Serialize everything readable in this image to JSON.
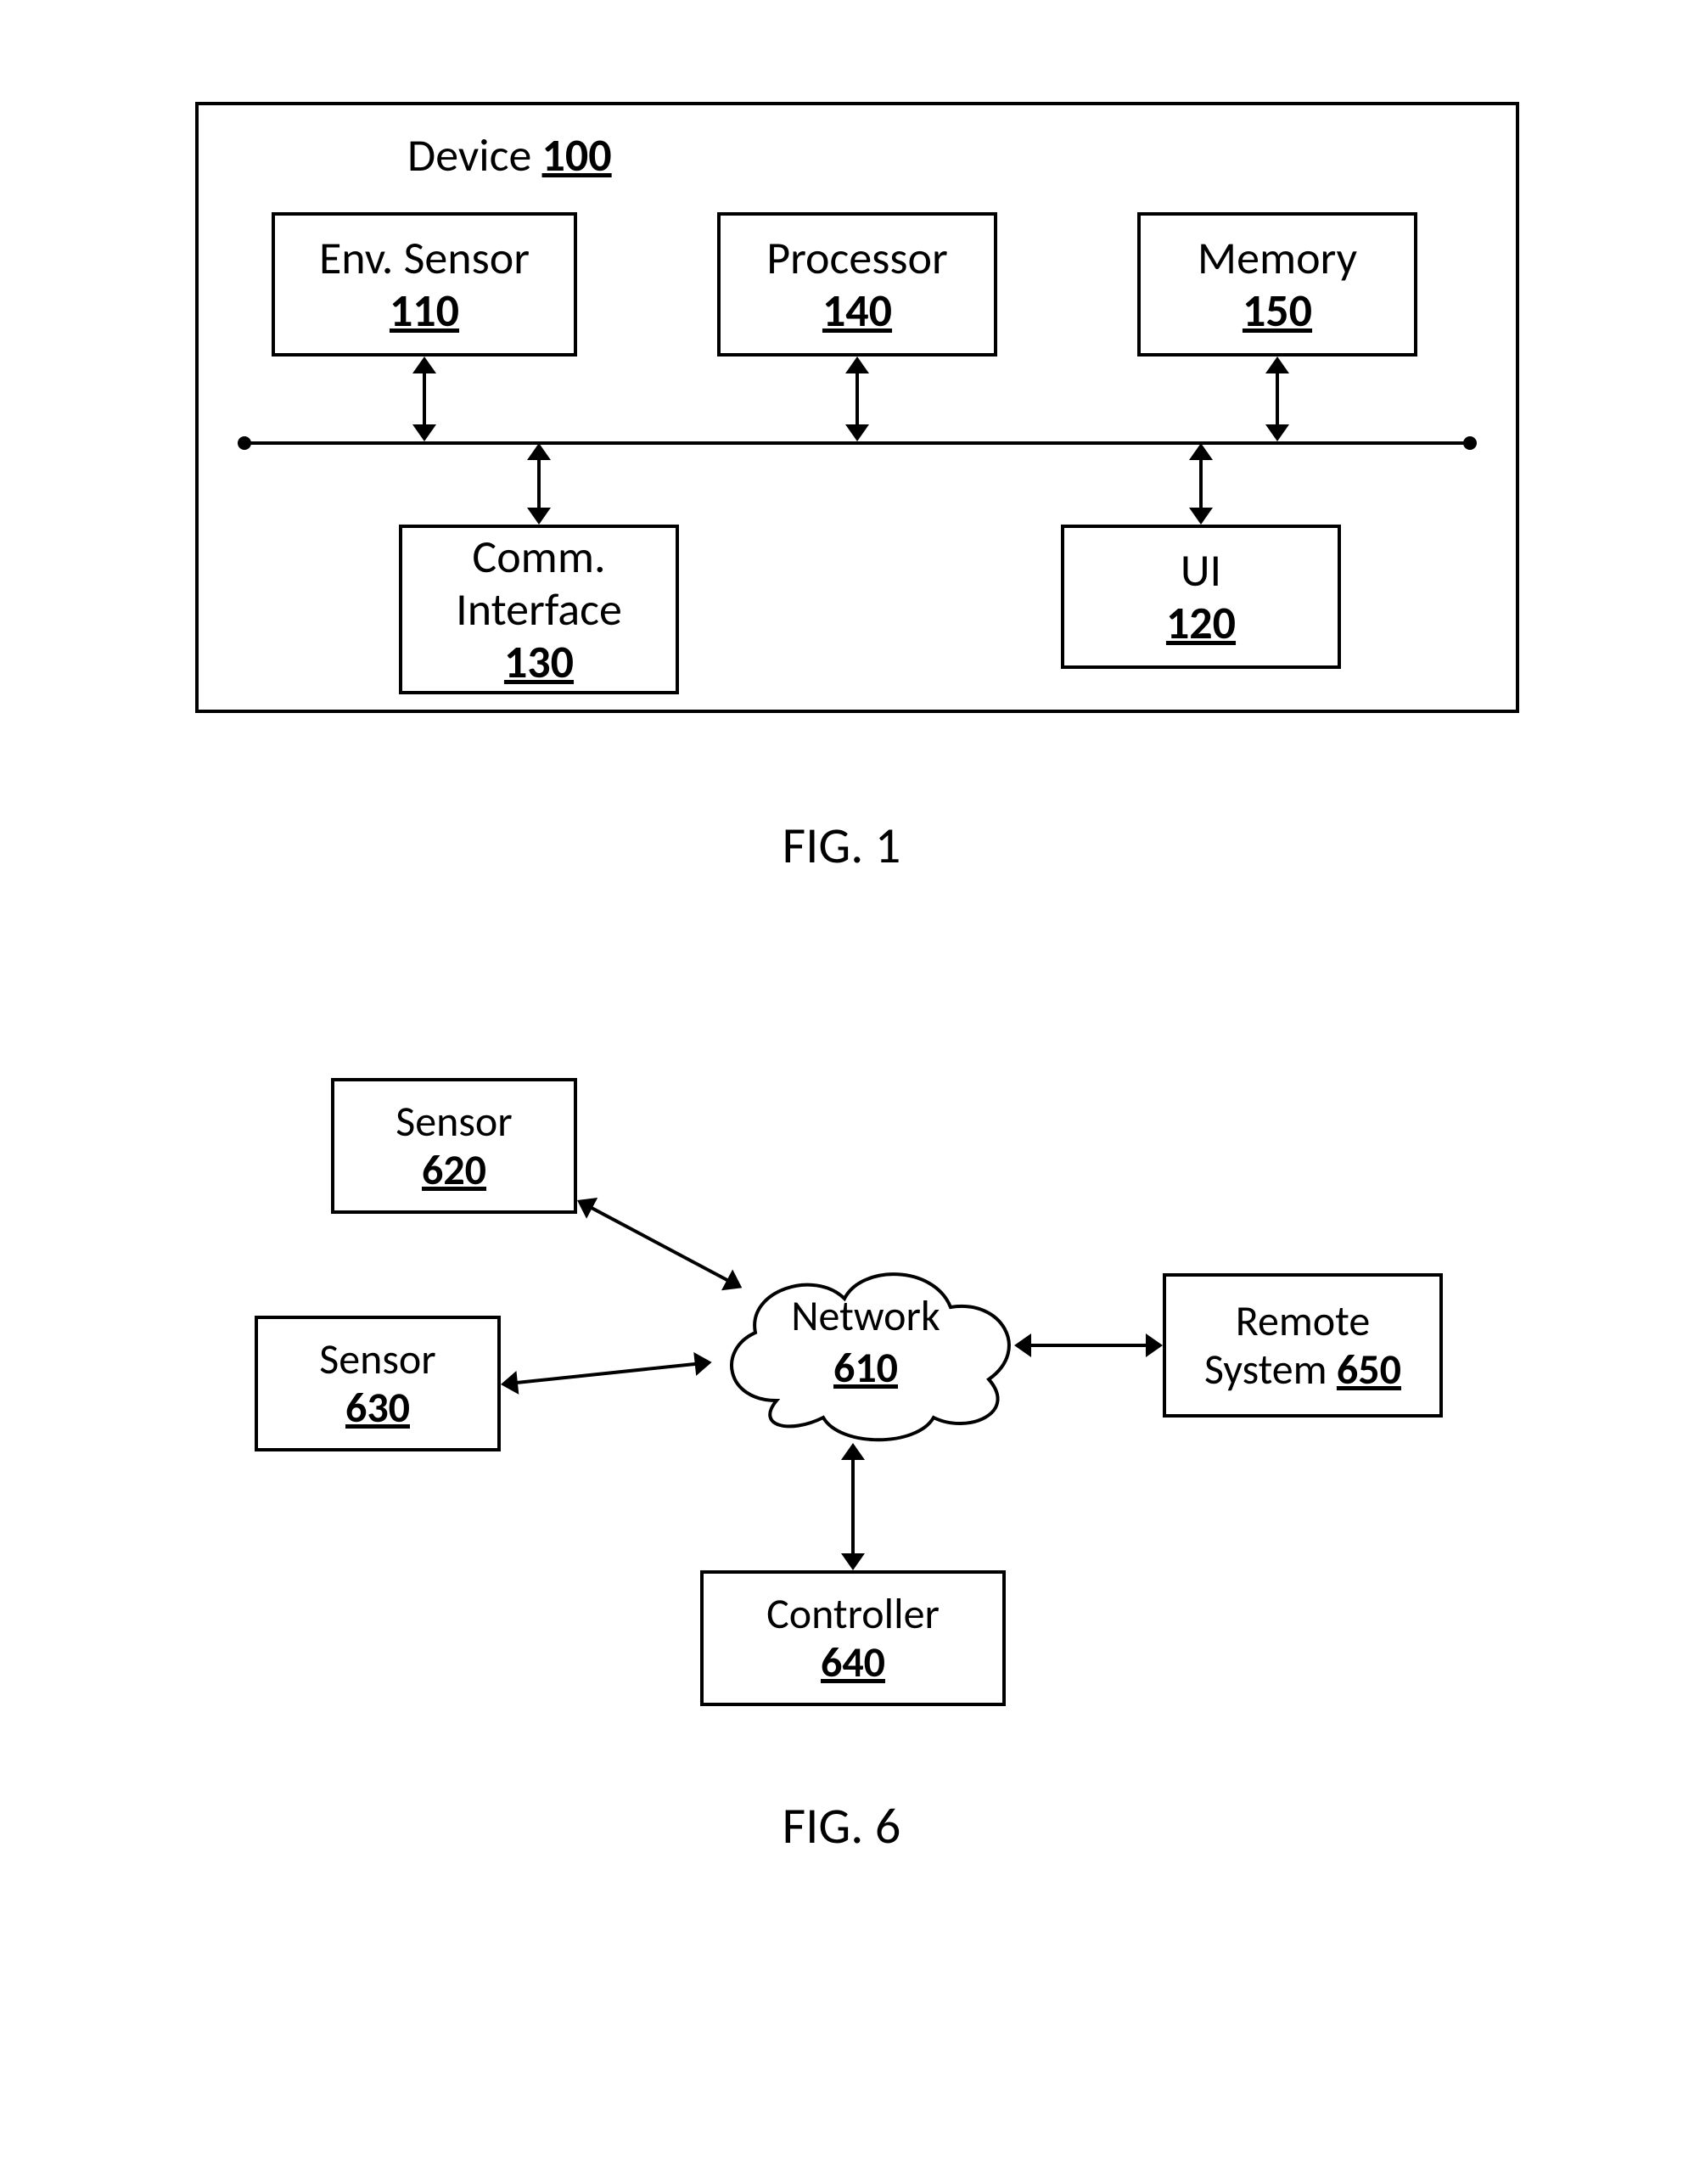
{
  "fig1": {
    "caption": "FIG. 1",
    "device": {
      "label": "Device",
      "ref": "100"
    },
    "blocks": {
      "envSensor": {
        "label": "Env. Sensor",
        "ref": "110"
      },
      "processor": {
        "label": "Processor",
        "ref": "140"
      },
      "memory": {
        "label": "Memory",
        "ref": "150"
      },
      "commIf": {
        "line1": "Comm.",
        "line2": "Interface",
        "ref": "130"
      },
      "ui": {
        "label": "UI",
        "ref": "120"
      }
    }
  },
  "fig6": {
    "caption": "FIG. 6",
    "network": {
      "label": "Network",
      "ref": "610"
    },
    "sensorA": {
      "label": "Sensor",
      "ref": "620"
    },
    "sensorB": {
      "label": "Sensor",
      "ref": "630"
    },
    "controller": {
      "label": "Controller",
      "ref": "640"
    },
    "remote": {
      "line1": "Remote",
      "line2": "System",
      "ref": "650"
    }
  }
}
